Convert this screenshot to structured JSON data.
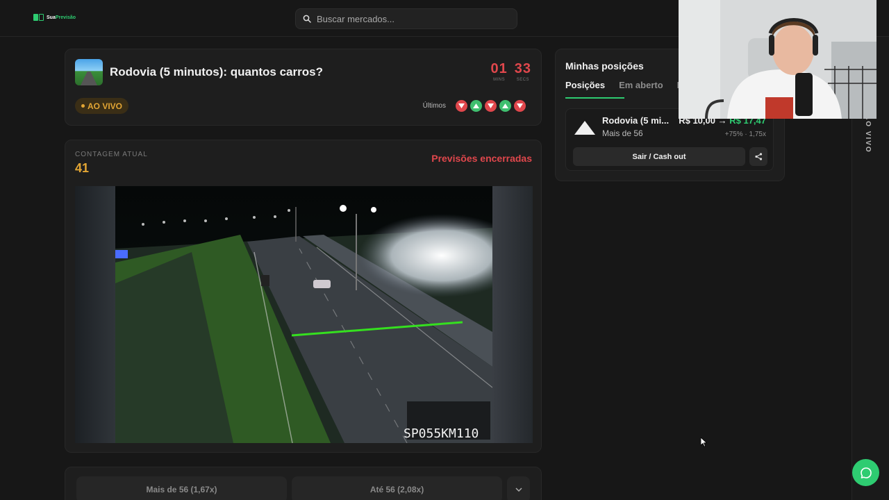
{
  "brand": {
    "prefix": "Sua",
    "accent": "Previsão"
  },
  "search": {
    "placeholder": "Buscar mercados..."
  },
  "market": {
    "title": "Rodovia (5 minutos): quantos carros?",
    "timer": {
      "minutes": "01",
      "minutes_label": "MINS",
      "seconds": "33",
      "seconds_label": "SECS"
    },
    "live_label": "AO VIVO",
    "recent_label": "Últimos",
    "recent_results": [
      "down",
      "up",
      "down",
      "up",
      "down"
    ]
  },
  "counter": {
    "label": "CONTAGEM ATUAL",
    "value": "41",
    "status": "Previsões encerradas",
    "camera_overlay": "SP055KM110"
  },
  "bets": {
    "option_1": "Mais de 56  (1,67x)",
    "option_2": "Até 56  (2,08x)"
  },
  "positions": {
    "title": "Minhas posições",
    "tabs": [
      "Posições",
      "Em aberto",
      "E"
    ],
    "item": {
      "market": "Rodovia (5 mi...",
      "choice": "Mais de 56",
      "stake": "R$ 10,00",
      "arrow": "→",
      "payout": "R$ 17,47",
      "meta": "+75% · 1,75x",
      "cashout_label": "Sair / Cash out"
    }
  },
  "rail": {
    "label": "AO VIVO"
  },
  "colors": {
    "accent": "#2ecc71",
    "danger": "#e0474c",
    "live": "#e2a534",
    "background": "#171717"
  }
}
